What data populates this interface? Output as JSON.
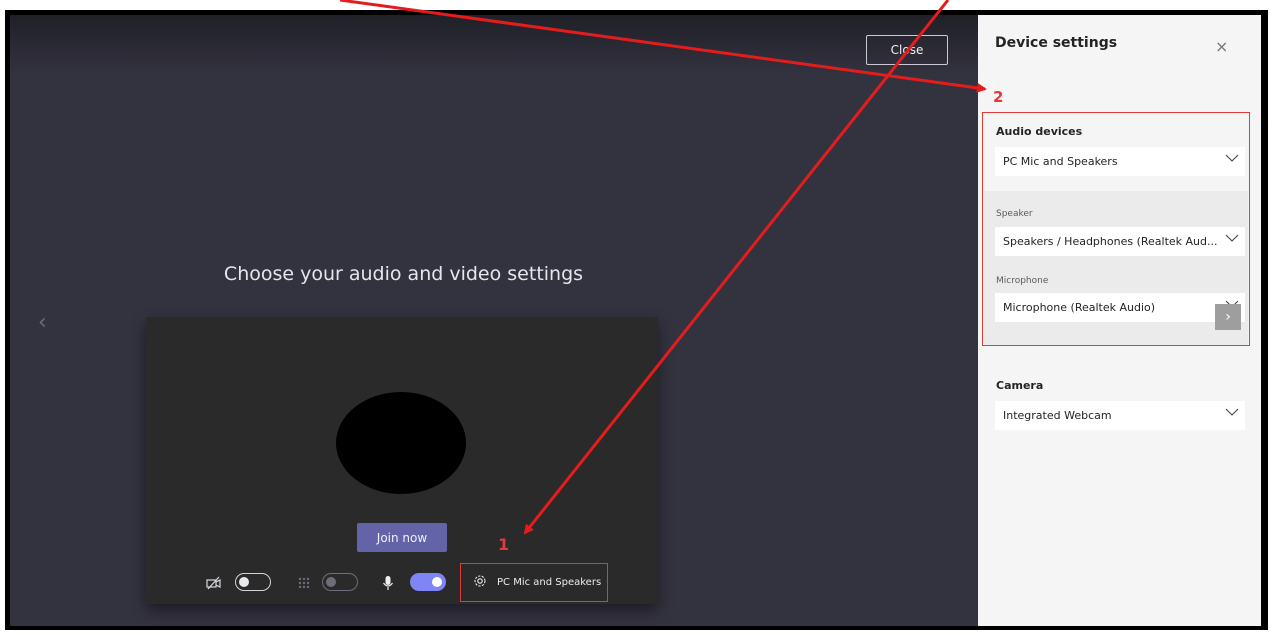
{
  "main": {
    "close_label": "Close",
    "title": "Choose your audio and video settings",
    "join_label": "Join now",
    "audio_device_label": "PC Mic and Speakers",
    "annotation_1": "1"
  },
  "panel": {
    "title": "Device settings",
    "annotation_2": "2",
    "audio_devices_label": "Audio devices",
    "audio_devices_value": "PC Mic and Speakers",
    "speaker_label": "Speaker",
    "speaker_value": "Speakers / Headphones (Realtek Aud...",
    "microphone_label": "Microphone",
    "microphone_value": "Microphone (Realtek Audio)",
    "camera_label": "Camera",
    "camera_value": "Integrated Webcam"
  },
  "controls": {
    "camera_on": false,
    "background_blur_on": false,
    "mic_on": true
  },
  "colors": {
    "accent": "#6264a7",
    "toggle_on": "#7f85f5",
    "annotation_red": "#e03a3a"
  }
}
